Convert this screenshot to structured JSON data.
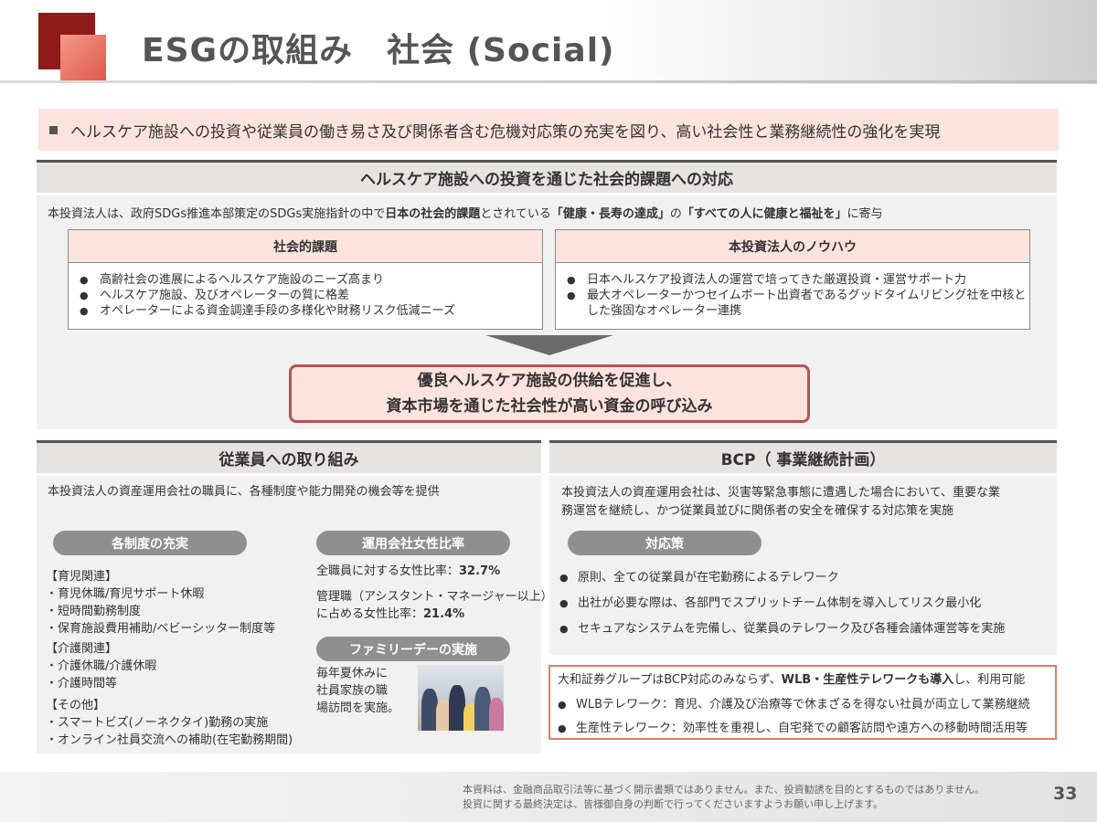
{
  "header": {
    "title": "ESGの取組み　社会 (Social)"
  },
  "intro": "ヘルスケア施設への投資や従業員の働き易さ及び関係者含む危機対応策の充実を図り、高い社会性と業務継続性の強化を実現",
  "section1": {
    "title": "ヘルスケア施設への投資を通じた社会的課題への対応",
    "desc_pre": "本投資法人は、政府SDGs推進本部策定のSDGs実施指針の中で",
    "desc_b1": "日本の社会的課題",
    "desc_mid1": "とされている",
    "desc_b2": "「健康・長寿の達成」",
    "desc_mid2": "の",
    "desc_b3": "「すべての人に健康と福祉を」",
    "desc_post": "に寄与",
    "left_box": {
      "title": "社会的課題",
      "items": [
        "高齢社会の進展によるヘルスケア施設のニーズ高まり",
        "ヘルスケア施設、及びオペレーターの質に格差",
        "オペレーターによる資金調達手段の多様化や財務リスク低減ニーズ"
      ]
    },
    "right_box": {
      "title": "本投資法人のノウハウ",
      "items": [
        "日本ヘルスケア投資法人の運営で培ってきた厳選投資・運営サポート力",
        "最大オペレーターかつセイムボート出資者であるグッドタイムリビング社を中核とした強固なオペレーター連携"
      ]
    },
    "conclusion_line1": "優良ヘルスケア施設の供給を促進し、",
    "conclusion_line2": "資本市場を通じた社会性が高い資金の呼び込み"
  },
  "employees": {
    "title": "従業員への取り組み",
    "desc": "本投資法人の資産運用会社の職員に、各種制度や能力開発の機会等を提供",
    "systems": {
      "pill": "各制度の充実",
      "childcare_head": "【育児関連】",
      "childcare": [
        "・育児休職/育児サポート休暇",
        "・短時間勤務制度",
        "・保育施設費用補助/ベビーシッター制度等"
      ],
      "nursing_head": "【介護関連】",
      "nursing": [
        "・介護休職/介護休暇",
        "・介護時間等"
      ],
      "other_head": "【その他】",
      "other": [
        "・スマートビズ(ノーネクタイ)勤務の実施",
        "・オンライン社員交流への補助(在宅勤務期間)"
      ]
    },
    "female_ratio": {
      "pill": "運用会社女性比率",
      "all_label": "全職員に対する女性比率：",
      "all_value": "32.7%",
      "mgmt_label_1": "管理職（アシスタント・マネージャー以上）",
      "mgmt_label_2": "に占める女性比率：",
      "mgmt_value": "21.4%"
    },
    "family_day": {
      "pill": "ファミリーデーの実施",
      "lines": [
        "毎年夏休みに",
        "社員家族の職",
        "場訪問を実施。"
      ]
    }
  },
  "bcp": {
    "title": "BCP（ 事業継続計画）",
    "desc_1": "本投資法人の資産運用会社は、災害等緊急事態に遭遇した場合において、重要な業",
    "desc_2": "務運営を継続し、かつ従業員並びに関係者の安全を確保する対応策を実施",
    "pill": "対応策",
    "items": [
      "原則、全ての従業員が在宅勤務によるテレワーク",
      "出社が必要な際は、各部門でスプリットチーム体制を導入してリスク最小化",
      "セキュアなシステムを完備し、従業員のテレワーク及び各種会議体運営等を実施"
    ],
    "daiwa_pre": "大和証券グループはBCP対応のみならず、",
    "daiwa_bold": "WLB・生産性テレワークも導入",
    "daiwa_post": "し、利用可能",
    "daiwa_items": [
      "WLBテレワーク：育児、介護及び治療等で休まざるを得ない社員が両立して業務継続",
      "生産性テレワーク：効率性を重視し、自宅発での顧客訪問や遠方への移動時間活用等"
    ]
  },
  "footer": {
    "line1": "本資料は、金融商品取引法等に基づく開示書類ではありません。また、投資勧誘を目的とするものではありません。",
    "line2": "投資に関する最終決定は、皆様御自身の判断で行ってくださいますようお願い申し上げます。",
    "page": "33"
  }
}
